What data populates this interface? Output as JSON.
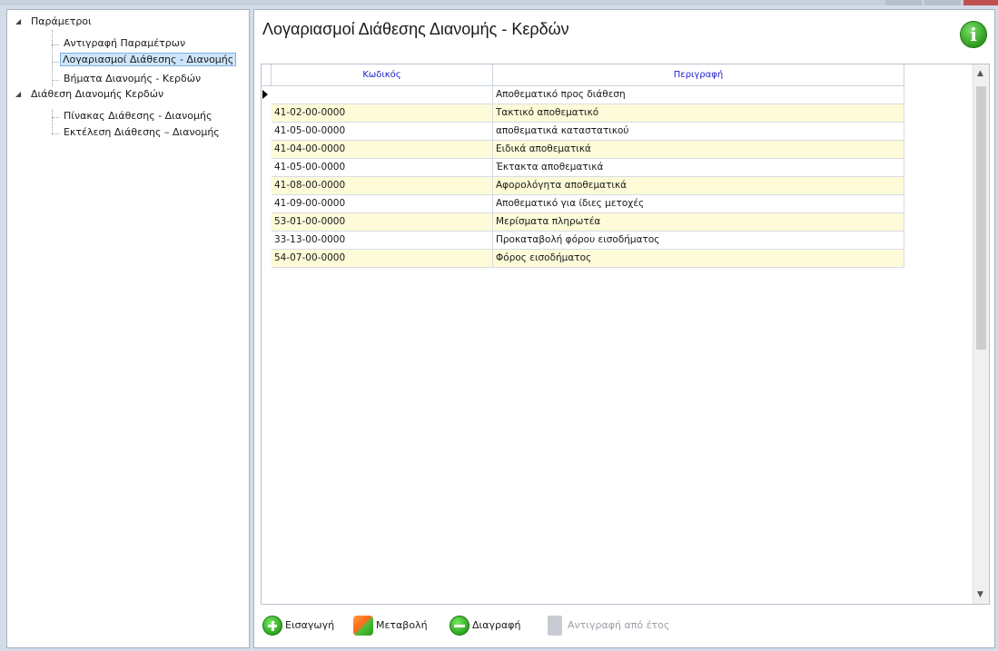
{
  "tree": {
    "nodes": [
      {
        "label": "Παράμετροι",
        "expander": "◢"
      },
      {
        "label": "Αντιγραφή Παραμέτρων"
      },
      {
        "label": "Λογαριασμοί Διάθεσης - Διανομής"
      },
      {
        "label": "Βήματα Διανομής - Κερδών"
      },
      {
        "label": "Διάθεση Διανομής Κερδών",
        "expander": "◢"
      },
      {
        "label": "Πίνακας Διάθεσης - Διανομής"
      },
      {
        "label": "Εκτέλεση Διάθεσης – Διανομής"
      }
    ],
    "selected_index": 2
  },
  "main": {
    "title": "Λογαριασμοί Διάθεσης Διανομής - Κερδών",
    "info_icon": "info-icon",
    "info_glyph": "i"
  },
  "grid": {
    "columns": [
      "Κωδικός",
      "Περιγραφή"
    ],
    "rows": [
      {
        "code": "",
        "description": "Αποθεματικό προς διάθεση"
      },
      {
        "code": "41-02-00-0000",
        "description": "Τακτικό αποθεματικό"
      },
      {
        "code": "41-05-00-0000",
        "description": "αποθεματικά καταστατικού"
      },
      {
        "code": "41-04-00-0000",
        "description": "Ειδικά αποθεματικά"
      },
      {
        "code": "41-05-00-0000",
        "description": "Έκτακτα αποθεματικά"
      },
      {
        "code": "41-08-00-0000",
        "description": "Αφορολόγητα αποθεματικά"
      },
      {
        "code": "41-09-00-0000",
        "description": "Αποθεματικό για ίδιες μετοχές"
      },
      {
        "code": "53-01-00-0000",
        "description": "Μερίσματα πληρωτέα"
      },
      {
        "code": "33-13-00-0000",
        "description": "Προκαταβολή φόρου εισοδήματος"
      },
      {
        "code": "54-07-00-0000",
        "description": "Φόρος εισοδήματος"
      }
    ],
    "current_row_index": 0,
    "row_alt_color": "#fdfbd8",
    "header_text_color": "#2020d0"
  },
  "toolbar": {
    "add_label": "Εισαγωγή",
    "edit_label": "Μεταβολή",
    "delete_label": "Διαγραφή",
    "copy_label": "Αντιγραφή από έτος"
  },
  "scroll": {
    "up_glyph": "▲",
    "down_glyph": "▼"
  }
}
